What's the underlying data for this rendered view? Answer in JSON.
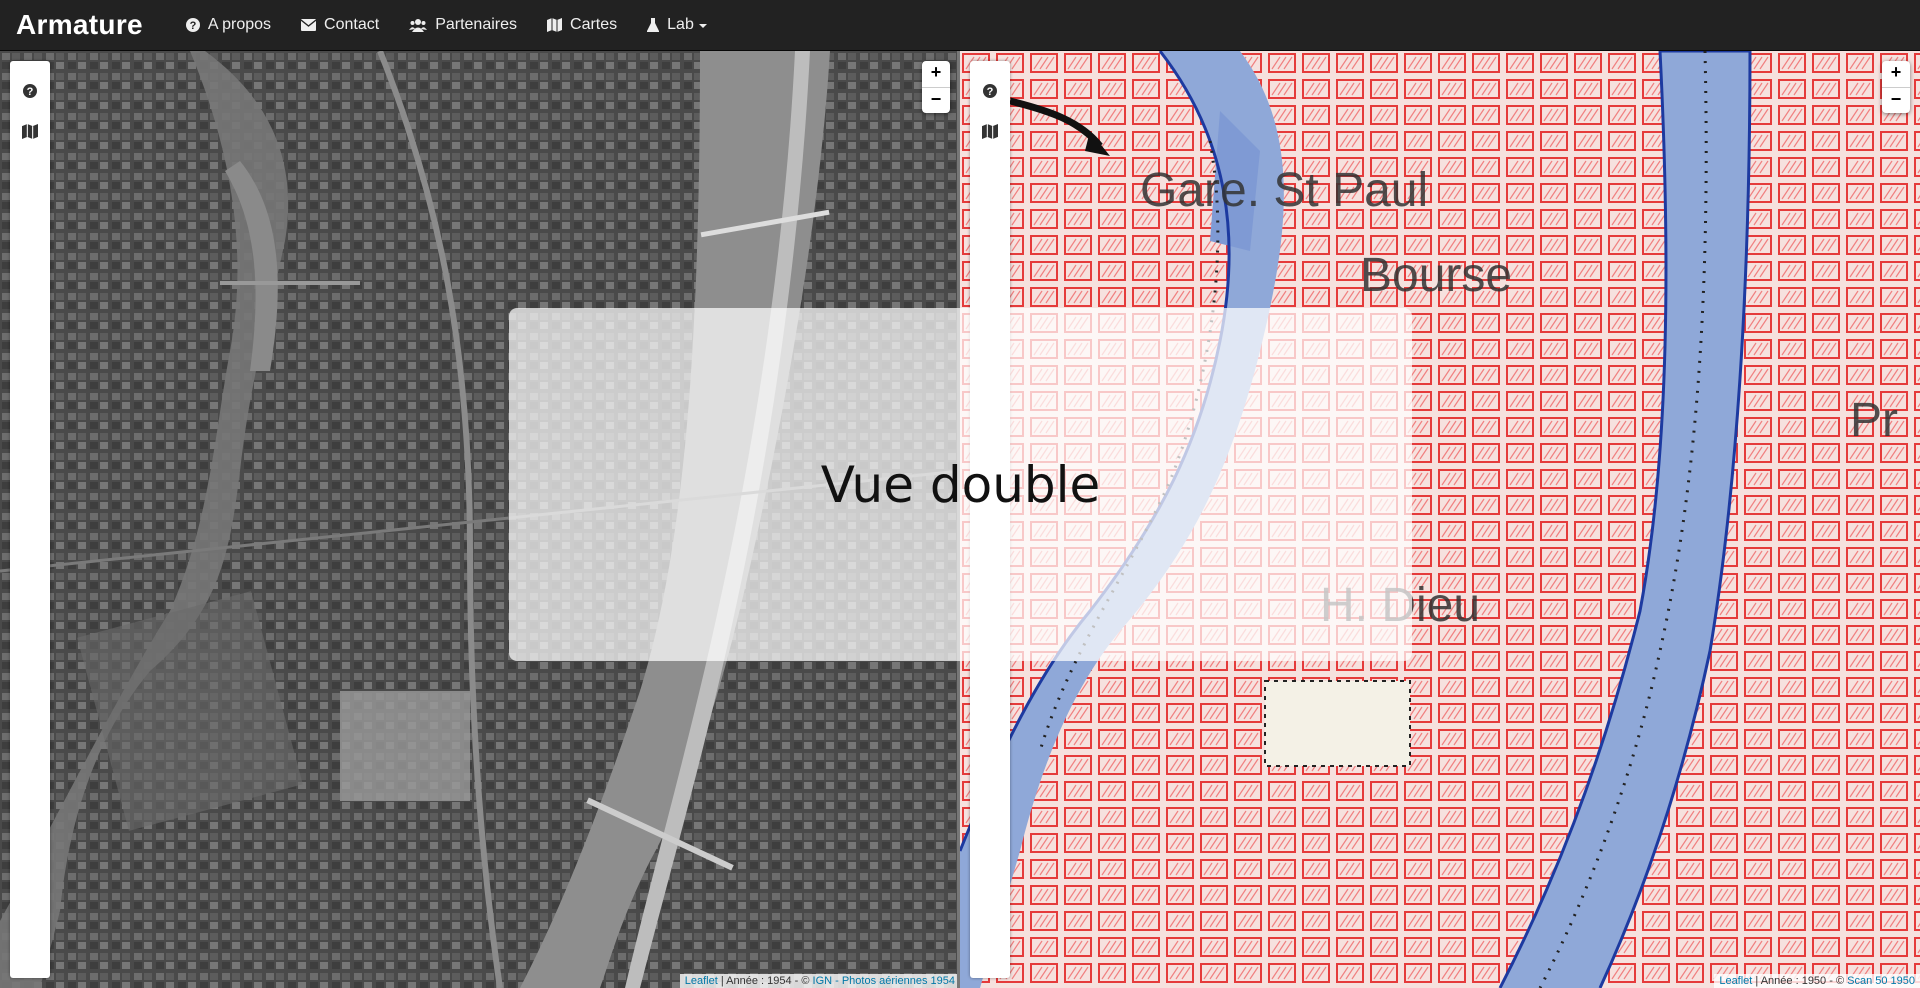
{
  "navbar": {
    "brand": "Armature",
    "items": [
      {
        "label": "A propos",
        "icon": "question-circle-icon"
      },
      {
        "label": "Contact",
        "icon": "envelope-icon"
      },
      {
        "label": "Partenaires",
        "icon": "users-icon"
      },
      {
        "label": "Cartes",
        "icon": "map-icon"
      },
      {
        "label": "Lab",
        "icon": "flask-icon",
        "dropdown": true
      }
    ]
  },
  "left_map": {
    "attribution": {
      "leaflet": "Leaflet",
      "text": " | Année : 1954 - © ",
      "source": "IGN - Photos aériennes 1954"
    }
  },
  "right_map": {
    "labels": [
      "Gare. St Paul",
      "Bourse",
      "H. Dieu",
      "Pr"
    ],
    "attribution": {
      "leaflet": "Leaflet",
      "text": " | Année : 1950 - © ",
      "source": "Scan 50 1950"
    }
  },
  "zoom": {
    "in": "+",
    "out": "−"
  },
  "overlay": {
    "title": "Vue double"
  },
  "colors": {
    "navbar": "#222222",
    "map_red": "#e53b3b",
    "water_blue": "#7f9ad4",
    "attrib_link": "#0078a8"
  }
}
